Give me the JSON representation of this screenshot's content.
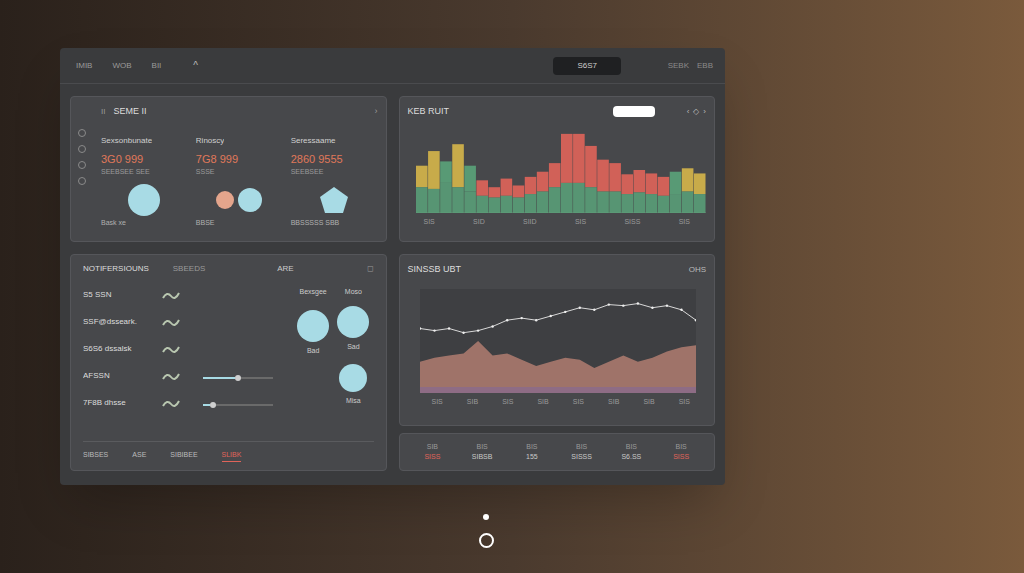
{
  "toolbar": {
    "tabs": [
      {
        "label": "IMIB",
        "selected": false
      },
      {
        "label": "WOB",
        "selected": false
      },
      {
        "label": "BII",
        "selected": false
      }
    ],
    "caret": "^",
    "button": "S6S7",
    "actions": [
      "SEBK",
      "EBB"
    ]
  },
  "summary": {
    "title": "SEME II",
    "badge": "II",
    "menu": "›",
    "stats": [
      {
        "label": "Sexsonbunate",
        "value": "3G0 999",
        "sub": "SEEBSEE SEE",
        "note": "Bask xe"
      },
      {
        "label": "Rinoscy",
        "value": "7G8 999",
        "sub": "SSSE",
        "note": "BBSE"
      },
      {
        "label": "Seressaame",
        "value": "2860 9555",
        "sub": "SEEBSEE",
        "note": "BBSSSSS SBB"
      }
    ]
  },
  "histogram": {
    "title": "KEB RUIT",
    "controls": [
      "‹",
      "◇",
      "›"
    ],
    "ticks": [
      "SIS",
      "SID",
      "SIID",
      "SIS",
      "SISS",
      "SIS"
    ],
    "bars": [
      {
        "base": 30,
        "value": 55,
        "color": "#d6b64a"
      },
      {
        "base": 28,
        "value": 72,
        "color": "#d6b64a"
      },
      {
        "base": 35,
        "value": 60,
        "color": "#5aa37a"
      },
      {
        "base": 30,
        "value": 80,
        "color": "#d6b64a"
      },
      {
        "base": 25,
        "value": 55,
        "color": "#5aa37a"
      },
      {
        "base": 20,
        "value": 38,
        "color": "#e0645a"
      },
      {
        "base": 18,
        "value": 30,
        "color": "#e0645a"
      },
      {
        "base": 20,
        "value": 40,
        "color": "#e0645a"
      },
      {
        "base": 18,
        "value": 32,
        "color": "#e0645a"
      },
      {
        "base": 22,
        "value": 42,
        "color": "#e0645a"
      },
      {
        "base": 25,
        "value": 48,
        "color": "#e0645a"
      },
      {
        "base": 30,
        "value": 58,
        "color": "#e0645a"
      },
      {
        "base": 35,
        "value": 92,
        "color": "#e0645a"
      },
      {
        "base": 35,
        "value": 92,
        "color": "#e0645a"
      },
      {
        "base": 30,
        "value": 78,
        "color": "#e0645a"
      },
      {
        "base": 25,
        "value": 62,
        "color": "#e0645a"
      },
      {
        "base": 25,
        "value": 58,
        "color": "#e0645a"
      },
      {
        "base": 22,
        "value": 45,
        "color": "#e0645a"
      },
      {
        "base": 24,
        "value": 50,
        "color": "#e0645a"
      },
      {
        "base": 22,
        "value": 46,
        "color": "#e0645a"
      },
      {
        "base": 20,
        "value": 42,
        "color": "#e0645a"
      },
      {
        "base": 22,
        "value": 48,
        "color": "#5aa37a"
      },
      {
        "base": 25,
        "value": 52,
        "color": "#d6b64a"
      },
      {
        "base": 22,
        "value": 46,
        "color": "#d6b64a"
      }
    ]
  },
  "notifications": {
    "title": "NOTIFERSIOUNS",
    "columns": [
      "SBEEDS",
      "ARE"
    ],
    "menu": "◻",
    "items": [
      {
        "label": "S5 SSN",
        "kind": "icon"
      },
      {
        "label": "SSF@dsseark.",
        "kind": "icon"
      },
      {
        "label": "S6S6 dssalsk",
        "kind": "icon"
      },
      {
        "label": "AFSSN",
        "kind": "slider",
        "level": 0.45
      },
      {
        "label": "7F8B dhsse",
        "kind": "slider",
        "level": 0.1
      }
    ],
    "gauges": [
      {
        "label": "Bexsgee",
        "caption": "Bad"
      },
      {
        "label": "Moso",
        "caption": "Sad"
      },
      {
        "label": "",
        "caption": "Misa"
      }
    ],
    "footer": [
      {
        "label": "SIBSES",
        "selected": false
      },
      {
        "label": "ASE",
        "selected": false
      },
      {
        "label": "SIBIBEE",
        "selected": false
      },
      {
        "label": "SLIBK",
        "selected": true
      }
    ]
  },
  "trend": {
    "title": "SINSSB UBT",
    "action": "OHS",
    "ticks": [
      "SIS",
      "SIB",
      "SIS",
      "SIB",
      "SIS",
      "SIB",
      "SIB",
      "SIS"
    ],
    "line": [
      62,
      60,
      62,
      58,
      60,
      64,
      70,
      72,
      70,
      74,
      78,
      82,
      80,
      85,
      84,
      86,
      82,
      84,
      80,
      70
    ],
    "area": [
      30,
      34,
      36,
      38,
      50,
      36,
      38,
      32,
      26,
      30,
      34,
      32,
      24,
      30,
      36,
      30,
      34,
      40,
      44,
      46
    ]
  },
  "table": {
    "columns": [
      "SIB",
      "BIS",
      "BIS",
      "BIS",
      "BIS",
      "BIS"
    ],
    "cells": [
      {
        "text": "SISS",
        "color": "#e0645a"
      },
      {
        "text": "SIBSB",
        "color": "#c9c9c9"
      },
      {
        "text": "155",
        "color": "#c9c9c9"
      },
      {
        "text": "SISSS",
        "color": "#c9c9c9"
      },
      {
        "text": "S6.SS",
        "color": "#c9c9c9"
      },
      {
        "text": "SISS",
        "color": "#e0645a"
      }
    ]
  }
}
